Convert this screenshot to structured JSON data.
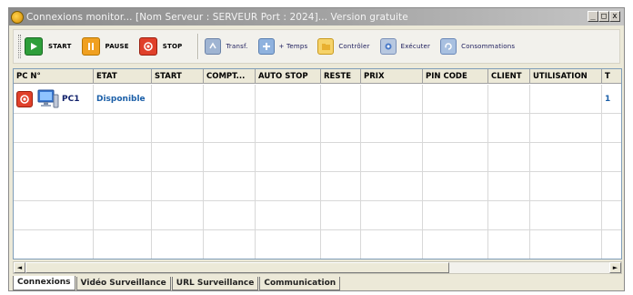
{
  "window": {
    "title": "Connexions monitor... [Nom Serveur : SERVEUR  Port : 2024]... Version gratuite",
    "controls": [
      "_",
      "□",
      "x"
    ]
  },
  "toolbar": {
    "start_label": "START",
    "pause_label": "PAUSE",
    "stop_label": "STOP",
    "transf_label": "Transf.",
    "plus_temps_label": "+ Temps",
    "controler_label": "Contrôler",
    "executer_label": "Exécuter",
    "consommations_label": "Consommations"
  },
  "grid": {
    "columns": [
      "PC N°",
      "ETAT",
      "START",
      "COMPT...",
      "AUTO STOP",
      "RESTE",
      "PRIX",
      "PIN CODE",
      "CLIENT",
      "UTILISATION",
      "T"
    ],
    "rows": [
      {
        "pc": "PC1",
        "etat": "Disponible",
        "start": "",
        "compt": "",
        "auto_stop": "",
        "reste": "",
        "prix": "",
        "pin": "",
        "client": "",
        "utilisation": "",
        "t": "1"
      }
    ]
  },
  "tabs": [
    "Connexions",
    "Vidéo Surveillance",
    "URL Surveillance",
    "Communication"
  ],
  "colors": {
    "title_bar": "#a4a4a4",
    "status_blue": "#1b5fa8",
    "start_green": "#2e9e3a",
    "pause_orange": "#f0a020",
    "stop_red": "#e0402a"
  },
  "icons": {
    "start": "play-icon",
    "pause": "pause-icon",
    "stop": "stop-icon",
    "transf": "transfer-icon",
    "plus_temps": "plus-icon",
    "controler": "folder-icon",
    "executer": "execute-icon",
    "consommations": "refresh-icon"
  }
}
